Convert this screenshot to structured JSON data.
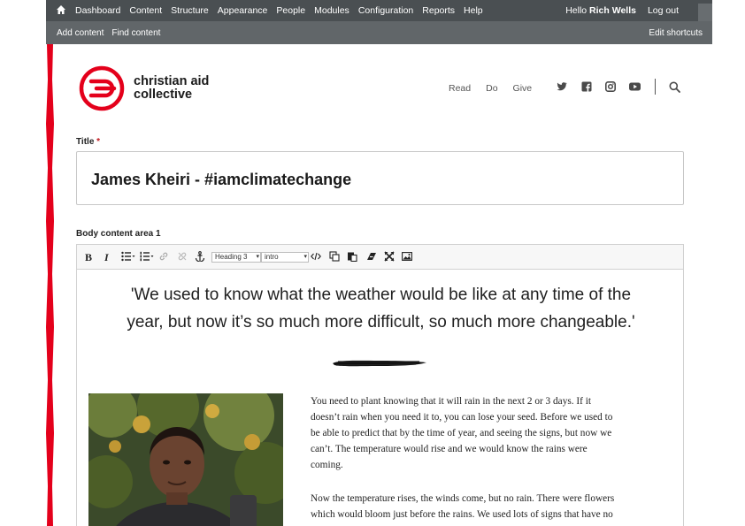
{
  "toolbar": {
    "menu": [
      "Dashboard",
      "Content",
      "Structure",
      "Appearance",
      "People",
      "Modules",
      "Configuration",
      "Reports",
      "Help"
    ],
    "greeting": "Hello",
    "user": "Rich Wells",
    "logout": "Log out"
  },
  "shortcuts": {
    "items": [
      "Add content",
      "Find content"
    ],
    "edit": "Edit shortcuts"
  },
  "site": {
    "logo_line1": "christian aid",
    "logo_line2": "collective",
    "nav": [
      "Read",
      "Do",
      "Give"
    ],
    "social_icons": [
      "twitter-icon",
      "facebook-icon",
      "instagram-icon",
      "youtube-icon"
    ],
    "brand_color": "#e4001b"
  },
  "form": {
    "title_label": "Title",
    "required_mark": "*",
    "title_value": "James Kheiri - #iamclimatechange",
    "body_label": "Body content area 1"
  },
  "editor": {
    "buttons": [
      "B",
      "I"
    ],
    "format_select": "Heading 3",
    "style_select": "intro",
    "quote_line1": "'We used to know what the weather would be like at any time of the",
    "quote_line2": "year, but now it’s so much more difficult, so much more changeable.'",
    "paragraph1": [
      "You need to plant knowing that it will rain in the next 2 or 3 days. If it",
      "doesn’t rain when you need it to, you can lose your seed. Before we used to",
      "be able to predict that by the time of year, and seeing the signs, but now we",
      "can’t. The temperature would rise and we would know the rains were",
      "coming."
    ],
    "paragraph2": [
      "Now the temperature rises, the winds come, but no rain. There were flowers",
      "which would bloom just before the rains. We used lots of signs that have no"
    ]
  }
}
